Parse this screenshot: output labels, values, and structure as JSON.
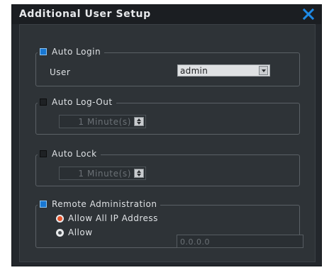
{
  "dialog": {
    "title": "Additional User Setup",
    "close_icon": "close-icon",
    "accent_color": "#1877d2"
  },
  "auto_login": {
    "label": "Auto Login",
    "checked": true,
    "user_label": "User",
    "user_value": "admin"
  },
  "auto_logout": {
    "label": "Auto Log-Out",
    "checked": false,
    "value": "1 Minute(s)"
  },
  "auto_lock": {
    "label": "Auto Lock",
    "checked": false,
    "value": "1 Minute(s)"
  },
  "remote_admin": {
    "label": "Remote Administration",
    "checked": true,
    "option_all": "Allow All IP Address",
    "option_allow": "Allow",
    "selected_option": "Allow All IP Address",
    "ip_value": "0.0.0.0"
  }
}
